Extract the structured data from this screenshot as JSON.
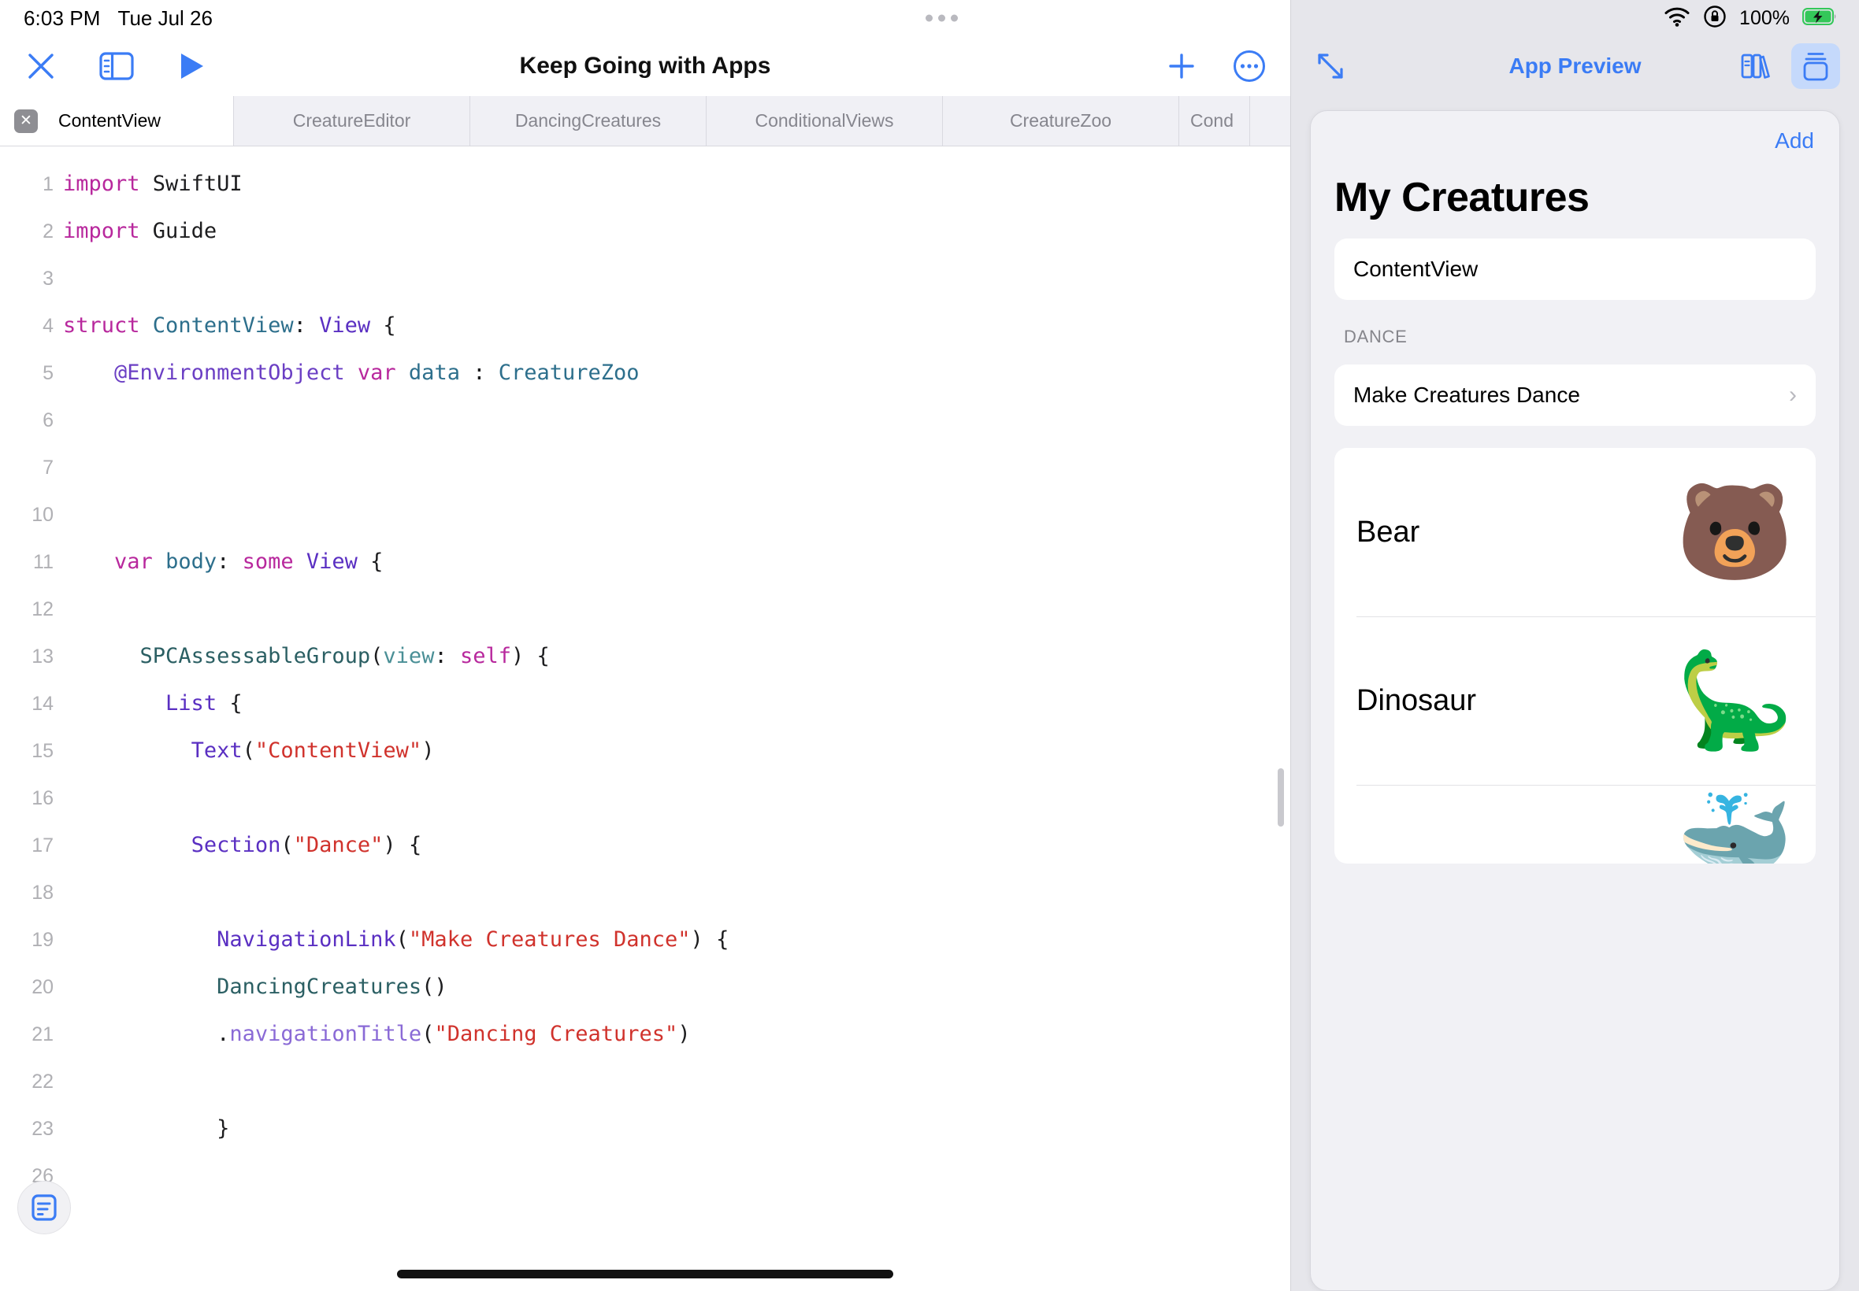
{
  "status_bar": {
    "time": "6:03 PM",
    "date": "Tue Jul 26",
    "battery_percent": "100%",
    "wifi_icon": "wifi-icon",
    "rotation_lock_icon": "rotation-lock-icon",
    "battery_icon": "battery-charging-icon",
    "battery_color": "#34c759"
  },
  "editor": {
    "toolbar": {
      "close_icon": "close-icon",
      "sidebar_icon": "sidebar-toggle-icon",
      "run_icon": "run-play-icon",
      "title": "Keep Going with Apps",
      "add_icon": "plus-icon",
      "more_icon": "more-ellipsis-icon",
      "accent_color": "#3b7cf5"
    },
    "tabs": [
      {
        "label": "ContentView",
        "active": true,
        "closable": true
      },
      {
        "label": "CreatureEditor",
        "active": false,
        "closable": false
      },
      {
        "label": "DancingCreatures",
        "active": false,
        "closable": false
      },
      {
        "label": "ConditionalViews",
        "active": false,
        "closable": false
      },
      {
        "label": "CreatureZoo",
        "active": false,
        "closable": false
      },
      {
        "label": "Cond",
        "active": false,
        "closable": false
      }
    ],
    "code_lines": [
      {
        "num": "1",
        "indent": 0
      },
      {
        "num": "2",
        "indent": 0
      },
      {
        "num": "3",
        "indent": 0
      },
      {
        "num": "4",
        "indent": 0
      },
      {
        "num": "5",
        "indent": 1
      },
      {
        "num": "6",
        "indent": 0
      },
      {
        "num": "7",
        "indent": 0
      },
      {
        "num": "10",
        "indent": 0
      },
      {
        "num": "11",
        "indent": 1
      },
      {
        "num": "12",
        "indent": 0
      },
      {
        "num": "13",
        "indent": 2
      },
      {
        "num": "14",
        "indent": 3
      },
      {
        "num": "15",
        "indent": 4
      },
      {
        "num": "16",
        "indent": 0
      },
      {
        "num": "17",
        "indent": 4
      },
      {
        "num": "18",
        "indent": 0
      },
      {
        "num": "19",
        "indent": 5
      },
      {
        "num": "20",
        "indent": 5
      },
      {
        "num": "21",
        "indent": 5
      },
      {
        "num": "22",
        "indent": 0
      },
      {
        "num": "23",
        "indent": 5
      },
      {
        "num": "26",
        "indent": 0
      }
    ],
    "code_text": {
      "l1_kw": "import",
      "l1_rest": " SwiftUI",
      "l2_kw": "import",
      "l2_rest": " Guide",
      "l4_kw": "struct",
      "l4_type": " ContentView",
      "l4_colon": ": ",
      "l4_view": "View",
      "l4_brace": " {",
      "l5_attr": "@EnvironmentObject",
      "l5_var": " var",
      "l5_name": " data",
      "l5_colon": " : ",
      "l5_type": "CreatureZoo",
      "l11_var": "var",
      "l11_body": " body",
      "l11_colon": ": ",
      "l11_some": "some",
      "l11_view": " View",
      "l11_brace": " {",
      "l13_fn": "SPCAssessableGroup",
      "l13_p1": "(",
      "l13_arg": "view",
      "l13_colon": ": ",
      "l13_self": "self",
      "l13_p2": ")",
      "l13_brace": " {",
      "l14_list": "List",
      "l14_brace": " {",
      "l15_text": "Text",
      "l15_p1": "(",
      "l15_str": "\"ContentView\"",
      "l15_p2": ")",
      "l17_section": "Section",
      "l17_p1": "(",
      "l17_str": "\"Dance\"",
      "l17_p2": ")",
      "l17_brace": " {",
      "l19_nav": "NavigationLink",
      "l19_p1": "(",
      "l19_str": "\"Make Creatures Dance\"",
      "l19_p2": ")",
      "l19_brace": " {",
      "l20_call": "DancingCreatures",
      "l20_p": "()",
      "l21_dot": ".",
      "l21_prop": "navigationTitle",
      "l21_p1": "(",
      "l21_str": "\"Dancing Creatures\"",
      "l21_p2": ")",
      "l23_brace": "}"
    },
    "doc_button_icon": "document-text-icon",
    "home_indicator": "home-indicator"
  },
  "preview": {
    "toolbar": {
      "expand_icon": "expand-diagonal-arrows-icon",
      "title": "App Preview",
      "books_icon": "book-library-icon",
      "app_icon": "app-stack-icon",
      "accent_color": "#3b7cf5",
      "selected_bg": "#c5d9fb"
    },
    "add_label": "Add",
    "heading": "My Creatures",
    "top_row_label": "ContentView",
    "section_label": "DANCE",
    "dance_row_label": "Make Creatures Dance",
    "chevron_icon": "chevron-right-icon",
    "creatures": [
      {
        "name": "Bear",
        "emoji": "🐻"
      },
      {
        "name": "Dinosaur",
        "emoji": "🦕"
      },
      {
        "name": "",
        "emoji": "🐳",
        "cut_off": true
      }
    ]
  }
}
